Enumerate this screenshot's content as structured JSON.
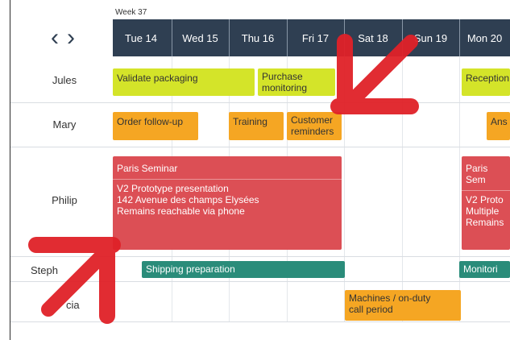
{
  "week_label": "Week 37",
  "nav": {
    "prev": "‹",
    "next": "›"
  },
  "days": [
    "Tue 14",
    "Wed 15",
    "Thu 16",
    "Fri 17",
    "Sat 18",
    "Sun 19",
    "Mon 20"
  ],
  "people": [
    "Jules",
    "Mary",
    "Philip",
    "Steph",
    "cia"
  ],
  "events": {
    "validate_packaging": "Validate packaging",
    "purchase_monitoring_1": "Purchase",
    "purchase_monitoring_2": "monitoring",
    "reception": "Reception",
    "order_followup": "Order follow-up",
    "training": "Training",
    "customer_reminders_1": "Customer",
    "customer_reminders_2": "reminders",
    "ans": "Ans",
    "paris_seminar": "Paris Seminar",
    "v2_line1": "V2 Prototype presentation",
    "v2_line2": "142 Avenue des champs Elysées",
    "v2_line3": "Remains reachable via phone",
    "paris_sem_right": "Paris Sem",
    "v2_right_1": "V2 Proto",
    "v2_right_2": "Multiple",
    "v2_right_3": "Remains",
    "shipping_preparation": "Shipping preparation",
    "monitoring_right": "Monitori",
    "machines_1": "Machines / on-duty",
    "machines_2": "call period"
  },
  "colors": {
    "header": "#2f3f52",
    "lime": "#d4e429",
    "orange": "#f5a623",
    "red": "#dc4f55",
    "teal": "#2a8c7a",
    "arrow": "#e02128"
  },
  "icons": [
    "chevron-left-icon",
    "chevron-right-icon",
    "arrow-annotation-icon"
  ]
}
